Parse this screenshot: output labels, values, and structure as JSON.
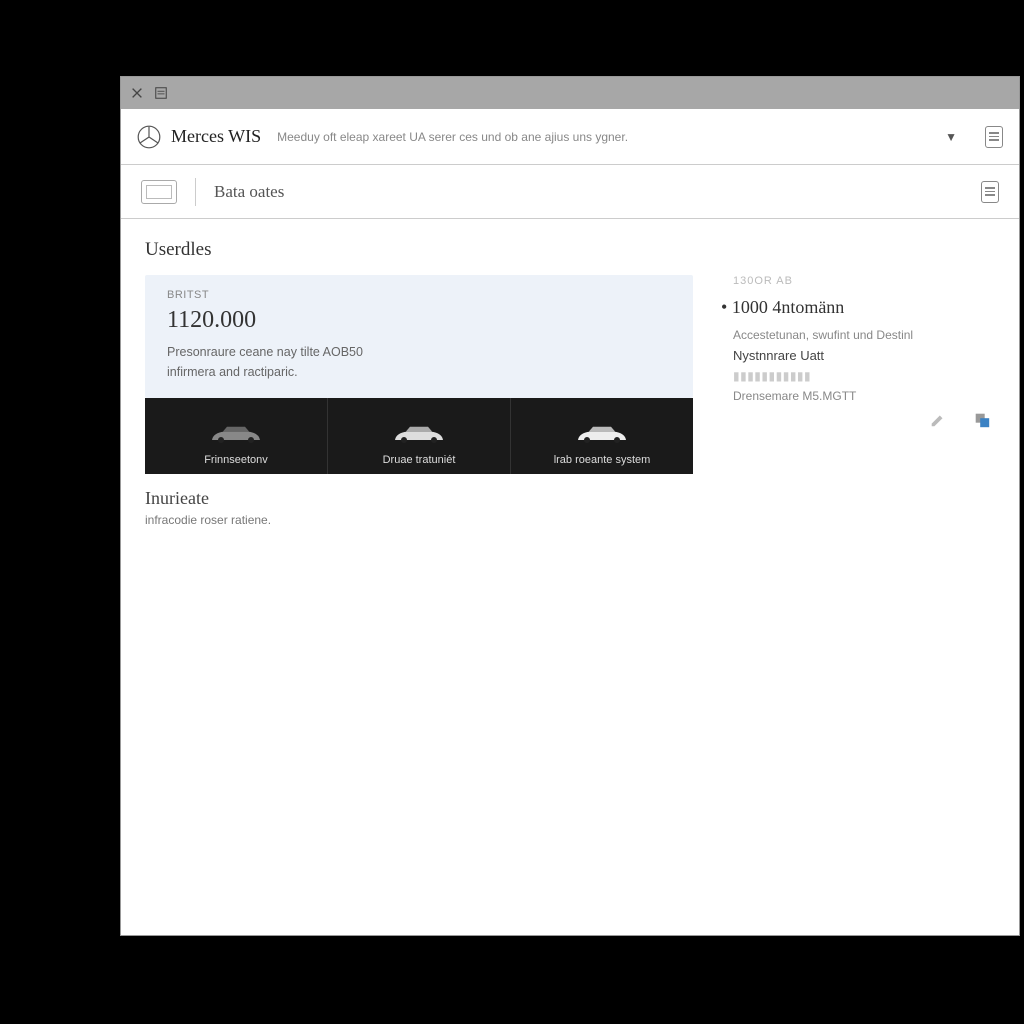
{
  "header": {
    "product": "Merces WIS",
    "subtitle": "Meeduy oft eleap xareet UA serer ces und ob ane ajius uns ygner."
  },
  "subheader": {
    "breadcrumb": "Bata oates"
  },
  "main": {
    "section_title": "Userdles",
    "card": {
      "eyebrow": "BRITST",
      "value": "1120.000",
      "desc_line1": "Presonraure ceane nay tilte AOB50",
      "desc_line2": "infirmera and ractiparic."
    },
    "vehicles": [
      {
        "label": "Frinnseetonv"
      },
      {
        "label": "Druae tratuniét"
      },
      {
        "label": "lrab roeante system"
      }
    ],
    "below": {
      "title": "Inurieate",
      "desc": "infracodie roser ratiene."
    }
  },
  "side": {
    "eyebrow": "130OR AB",
    "title": "1000 4ntomänn",
    "line1": "Accestetunan, swufint und Destinl",
    "line2": "Nystnnrare Uatt",
    "line3": "Drensemare M5.MGTT"
  }
}
